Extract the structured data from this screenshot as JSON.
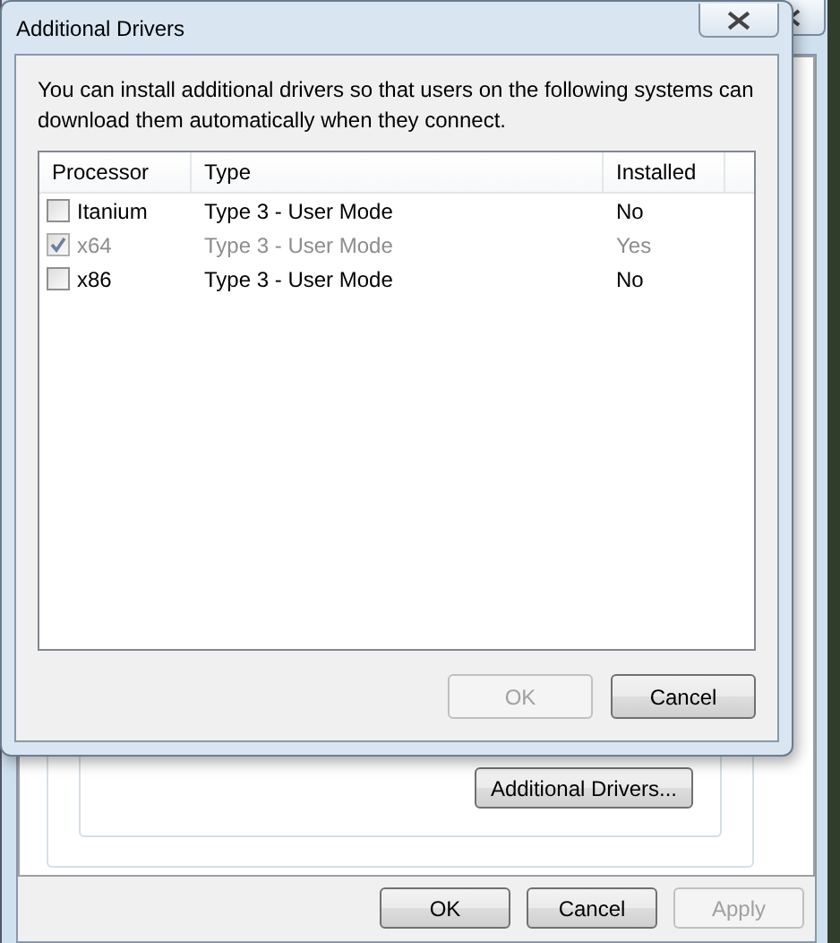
{
  "background_window": {
    "panel_button": {
      "label": "Additional Drivers..."
    },
    "buttons": [
      {
        "label": "OK",
        "disabled": false
      },
      {
        "label": "Cancel",
        "disabled": false
      },
      {
        "label": "Apply",
        "disabled": true
      }
    ]
  },
  "dialog": {
    "title": "Additional Drivers",
    "description": "You can install additional drivers so that users on the following systems can download them automatically when they connect.",
    "table": {
      "columns": [
        "Processor",
        "Type",
        "Installed"
      ],
      "rows": [
        {
          "processor": "Itanium",
          "type": "Type 3 - User Mode",
          "installed": "No",
          "checked": false,
          "disabled": false
        },
        {
          "processor": "x64",
          "type": "Type 3 - User Mode",
          "installed": "Yes",
          "checked": true,
          "disabled": true
        },
        {
          "processor": "x86",
          "type": "Type 3 - User Mode",
          "installed": "No",
          "checked": false,
          "disabled": false
        }
      ]
    },
    "buttons": [
      {
        "label": "OK",
        "disabled": true
      },
      {
        "label": "Cancel",
        "disabled": false
      }
    ]
  }
}
